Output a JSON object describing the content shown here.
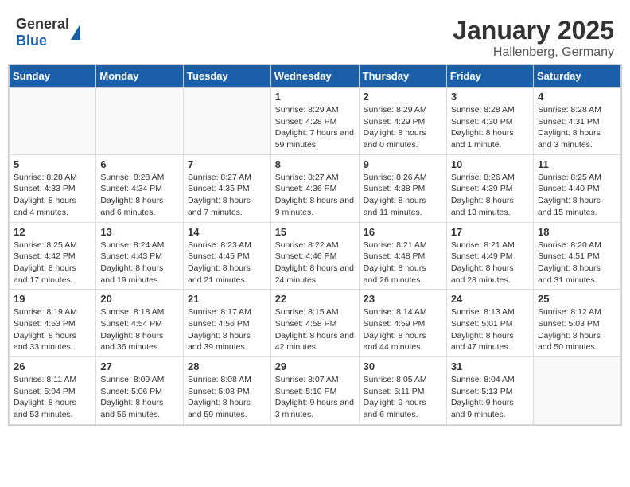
{
  "header": {
    "logo_general": "General",
    "logo_blue": "Blue",
    "month": "January 2025",
    "location": "Hallenberg, Germany"
  },
  "days_of_week": [
    "Sunday",
    "Monday",
    "Tuesday",
    "Wednesday",
    "Thursday",
    "Friday",
    "Saturday"
  ],
  "weeks": [
    [
      {
        "day": "",
        "sunrise": "",
        "sunset": "",
        "daylight": ""
      },
      {
        "day": "",
        "sunrise": "",
        "sunset": "",
        "daylight": ""
      },
      {
        "day": "",
        "sunrise": "",
        "sunset": "",
        "daylight": ""
      },
      {
        "day": "1",
        "sunrise": "Sunrise: 8:29 AM",
        "sunset": "Sunset: 4:28 PM",
        "daylight": "Daylight: 7 hours and 59 minutes."
      },
      {
        "day": "2",
        "sunrise": "Sunrise: 8:29 AM",
        "sunset": "Sunset: 4:29 PM",
        "daylight": "Daylight: 8 hours and 0 minutes."
      },
      {
        "day": "3",
        "sunrise": "Sunrise: 8:28 AM",
        "sunset": "Sunset: 4:30 PM",
        "daylight": "Daylight: 8 hours and 1 minute."
      },
      {
        "day": "4",
        "sunrise": "Sunrise: 8:28 AM",
        "sunset": "Sunset: 4:31 PM",
        "daylight": "Daylight: 8 hours and 3 minutes."
      }
    ],
    [
      {
        "day": "5",
        "sunrise": "Sunrise: 8:28 AM",
        "sunset": "Sunset: 4:33 PM",
        "daylight": "Daylight: 8 hours and 4 minutes."
      },
      {
        "day": "6",
        "sunrise": "Sunrise: 8:28 AM",
        "sunset": "Sunset: 4:34 PM",
        "daylight": "Daylight: 8 hours and 6 minutes."
      },
      {
        "day": "7",
        "sunrise": "Sunrise: 8:27 AM",
        "sunset": "Sunset: 4:35 PM",
        "daylight": "Daylight: 8 hours and 7 minutes."
      },
      {
        "day": "8",
        "sunrise": "Sunrise: 8:27 AM",
        "sunset": "Sunset: 4:36 PM",
        "daylight": "Daylight: 8 hours and 9 minutes."
      },
      {
        "day": "9",
        "sunrise": "Sunrise: 8:26 AM",
        "sunset": "Sunset: 4:38 PM",
        "daylight": "Daylight: 8 hours and 11 minutes."
      },
      {
        "day": "10",
        "sunrise": "Sunrise: 8:26 AM",
        "sunset": "Sunset: 4:39 PM",
        "daylight": "Daylight: 8 hours and 13 minutes."
      },
      {
        "day": "11",
        "sunrise": "Sunrise: 8:25 AM",
        "sunset": "Sunset: 4:40 PM",
        "daylight": "Daylight: 8 hours and 15 minutes."
      }
    ],
    [
      {
        "day": "12",
        "sunrise": "Sunrise: 8:25 AM",
        "sunset": "Sunset: 4:42 PM",
        "daylight": "Daylight: 8 hours and 17 minutes."
      },
      {
        "day": "13",
        "sunrise": "Sunrise: 8:24 AM",
        "sunset": "Sunset: 4:43 PM",
        "daylight": "Daylight: 8 hours and 19 minutes."
      },
      {
        "day": "14",
        "sunrise": "Sunrise: 8:23 AM",
        "sunset": "Sunset: 4:45 PM",
        "daylight": "Daylight: 8 hours and 21 minutes."
      },
      {
        "day": "15",
        "sunrise": "Sunrise: 8:22 AM",
        "sunset": "Sunset: 4:46 PM",
        "daylight": "Daylight: 8 hours and 24 minutes."
      },
      {
        "day": "16",
        "sunrise": "Sunrise: 8:21 AM",
        "sunset": "Sunset: 4:48 PM",
        "daylight": "Daylight: 8 hours and 26 minutes."
      },
      {
        "day": "17",
        "sunrise": "Sunrise: 8:21 AM",
        "sunset": "Sunset: 4:49 PM",
        "daylight": "Daylight: 8 hours and 28 minutes."
      },
      {
        "day": "18",
        "sunrise": "Sunrise: 8:20 AM",
        "sunset": "Sunset: 4:51 PM",
        "daylight": "Daylight: 8 hours and 31 minutes."
      }
    ],
    [
      {
        "day": "19",
        "sunrise": "Sunrise: 8:19 AM",
        "sunset": "Sunset: 4:53 PM",
        "daylight": "Daylight: 8 hours and 33 minutes."
      },
      {
        "day": "20",
        "sunrise": "Sunrise: 8:18 AM",
        "sunset": "Sunset: 4:54 PM",
        "daylight": "Daylight: 8 hours and 36 minutes."
      },
      {
        "day": "21",
        "sunrise": "Sunrise: 8:17 AM",
        "sunset": "Sunset: 4:56 PM",
        "daylight": "Daylight: 8 hours and 39 minutes."
      },
      {
        "day": "22",
        "sunrise": "Sunrise: 8:15 AM",
        "sunset": "Sunset: 4:58 PM",
        "daylight": "Daylight: 8 hours and 42 minutes."
      },
      {
        "day": "23",
        "sunrise": "Sunrise: 8:14 AM",
        "sunset": "Sunset: 4:59 PM",
        "daylight": "Daylight: 8 hours and 44 minutes."
      },
      {
        "day": "24",
        "sunrise": "Sunrise: 8:13 AM",
        "sunset": "Sunset: 5:01 PM",
        "daylight": "Daylight: 8 hours and 47 minutes."
      },
      {
        "day": "25",
        "sunrise": "Sunrise: 8:12 AM",
        "sunset": "Sunset: 5:03 PM",
        "daylight": "Daylight: 8 hours and 50 minutes."
      }
    ],
    [
      {
        "day": "26",
        "sunrise": "Sunrise: 8:11 AM",
        "sunset": "Sunset: 5:04 PM",
        "daylight": "Daylight: 8 hours and 53 minutes."
      },
      {
        "day": "27",
        "sunrise": "Sunrise: 8:09 AM",
        "sunset": "Sunset: 5:06 PM",
        "daylight": "Daylight: 8 hours and 56 minutes."
      },
      {
        "day": "28",
        "sunrise": "Sunrise: 8:08 AM",
        "sunset": "Sunset: 5:08 PM",
        "daylight": "Daylight: 8 hours and 59 minutes."
      },
      {
        "day": "29",
        "sunrise": "Sunrise: 8:07 AM",
        "sunset": "Sunset: 5:10 PM",
        "daylight": "Daylight: 9 hours and 3 minutes."
      },
      {
        "day": "30",
        "sunrise": "Sunrise: 8:05 AM",
        "sunset": "Sunset: 5:11 PM",
        "daylight": "Daylight: 9 hours and 6 minutes."
      },
      {
        "day": "31",
        "sunrise": "Sunrise: 8:04 AM",
        "sunset": "Sunset: 5:13 PM",
        "daylight": "Daylight: 9 hours and 9 minutes."
      },
      {
        "day": "",
        "sunrise": "",
        "sunset": "",
        "daylight": ""
      }
    ]
  ]
}
